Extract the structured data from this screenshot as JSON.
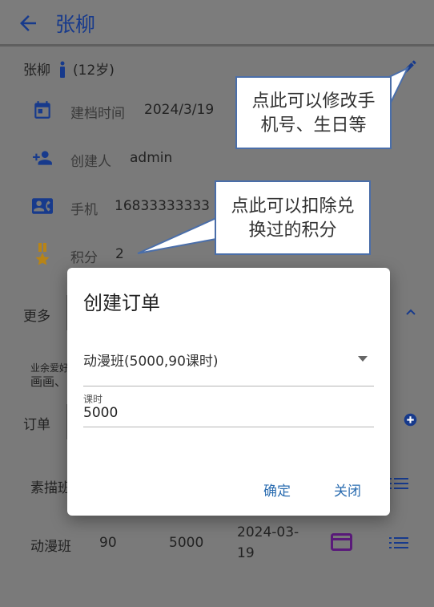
{
  "appbar": {
    "title": "张柳"
  },
  "profile": {
    "name": "张柳",
    "age": "(12岁)",
    "archive_label": "建档时间",
    "archive_value": "2024/3/19",
    "creator_label": "创建人",
    "creator_value": "admin",
    "phone_label": "手机",
    "phone_value": "16833333333",
    "points_label": "积分",
    "points_value": "2"
  },
  "sections": {
    "more_label": "更多",
    "hobby_label": "业余爱好",
    "hobby_value": "画画、",
    "orders_label": "订单"
  },
  "orders": [
    {
      "name": "素描班"
    },
    {
      "name": "动漫班",
      "hours": "90",
      "amount": "5000",
      "date_line1": "2024-03-",
      "date_line2": "19"
    }
  ],
  "callouts": {
    "edit_line1": "点此可以修改手",
    "edit_line2": "机号、生日等",
    "points_line1": "点此可以扣除兑",
    "points_line2": "换过的积分"
  },
  "dialog": {
    "title": "创建订单",
    "course_value": "动漫班(5000,90课时)",
    "hours_label": "课时",
    "hours_value": "5000",
    "confirm": "确定",
    "close": "关闭"
  }
}
